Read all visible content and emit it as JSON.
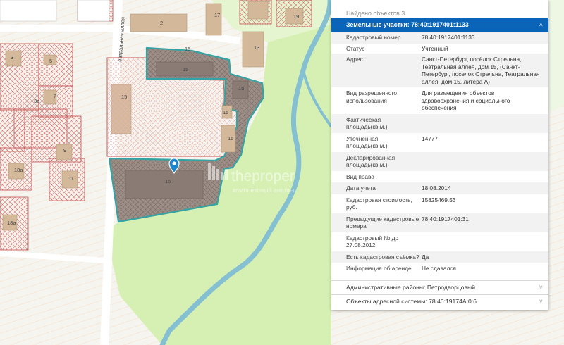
{
  "map": {
    "street_label": "Театральная аллея",
    "building_labels": [
      "2",
      "3",
      "5",
      "7",
      "3а",
      "9",
      "11",
      "13",
      "15",
      "15",
      "15",
      "15",
      "15",
      "15",
      "15",
      "17",
      "18а",
      "18а",
      "19"
    ],
    "watermark_text": "theproper",
    "watermark_sub": "комплексный анализ",
    "colors": {
      "background": "#f6f4ee",
      "park": "#d6f0b3",
      "river": "#84c0d2",
      "parcel_outline": "#c65050",
      "selected_fill": "#9c8e87",
      "selected_border": "#35a3a3",
      "building": "#d4b89a",
      "road": "#ffffff"
    },
    "marker_icon": "map-pin-icon"
  },
  "panel": {
    "found_text": "Найдено объектов 3",
    "section_title": "Земельные участки: 78:40:1917401:1133",
    "rows": [
      {
        "key": "Кадастровый номер",
        "value": "78:40:1917401:1133"
      },
      {
        "key": "Статус",
        "value": "Учтенный"
      },
      {
        "key": "Адрес",
        "value": "Санкт-Петербург, посёлок Стрельна, Театральная аллея, дом 15, (Санкт-Петербург, поселок Стрельна, Театральная аллея, дом 15, литера А)"
      },
      {
        "key": "Вид разрешенного использования",
        "value": "Для размещения объектов здравоохранения и социального обеспечения"
      },
      {
        "key": "Фактическая площадь(кв.м.)",
        "value": ""
      },
      {
        "key": "Уточненная площадь(кв.м.)",
        "value": "14777"
      },
      {
        "key": "Декларированная площадь(кв.м.)",
        "value": ""
      },
      {
        "key": "Вид права",
        "value": ""
      },
      {
        "key": "Дата учета",
        "value": "18.08.2014"
      },
      {
        "key": "Кадастровая стоимость, руб.",
        "value": "15825469.53"
      },
      {
        "key": "Предыдущие кадастровые номера",
        "value": "78:40:1917401:31"
      },
      {
        "key": "Кадастровый № до 27.08.2012",
        "value": ""
      },
      {
        "key": "Есть кадастровая съёмка?",
        "value": "Да"
      },
      {
        "key": "Информация об аренде",
        "value": "Не сдавался"
      }
    ],
    "collapsed_sections": [
      {
        "label": "Административные районы: Петродворцовый"
      },
      {
        "label": "Объекты адресной системы: 78:40:19174А:0:6"
      }
    ],
    "chevron_up": "˄",
    "chevron_down": "˅"
  }
}
